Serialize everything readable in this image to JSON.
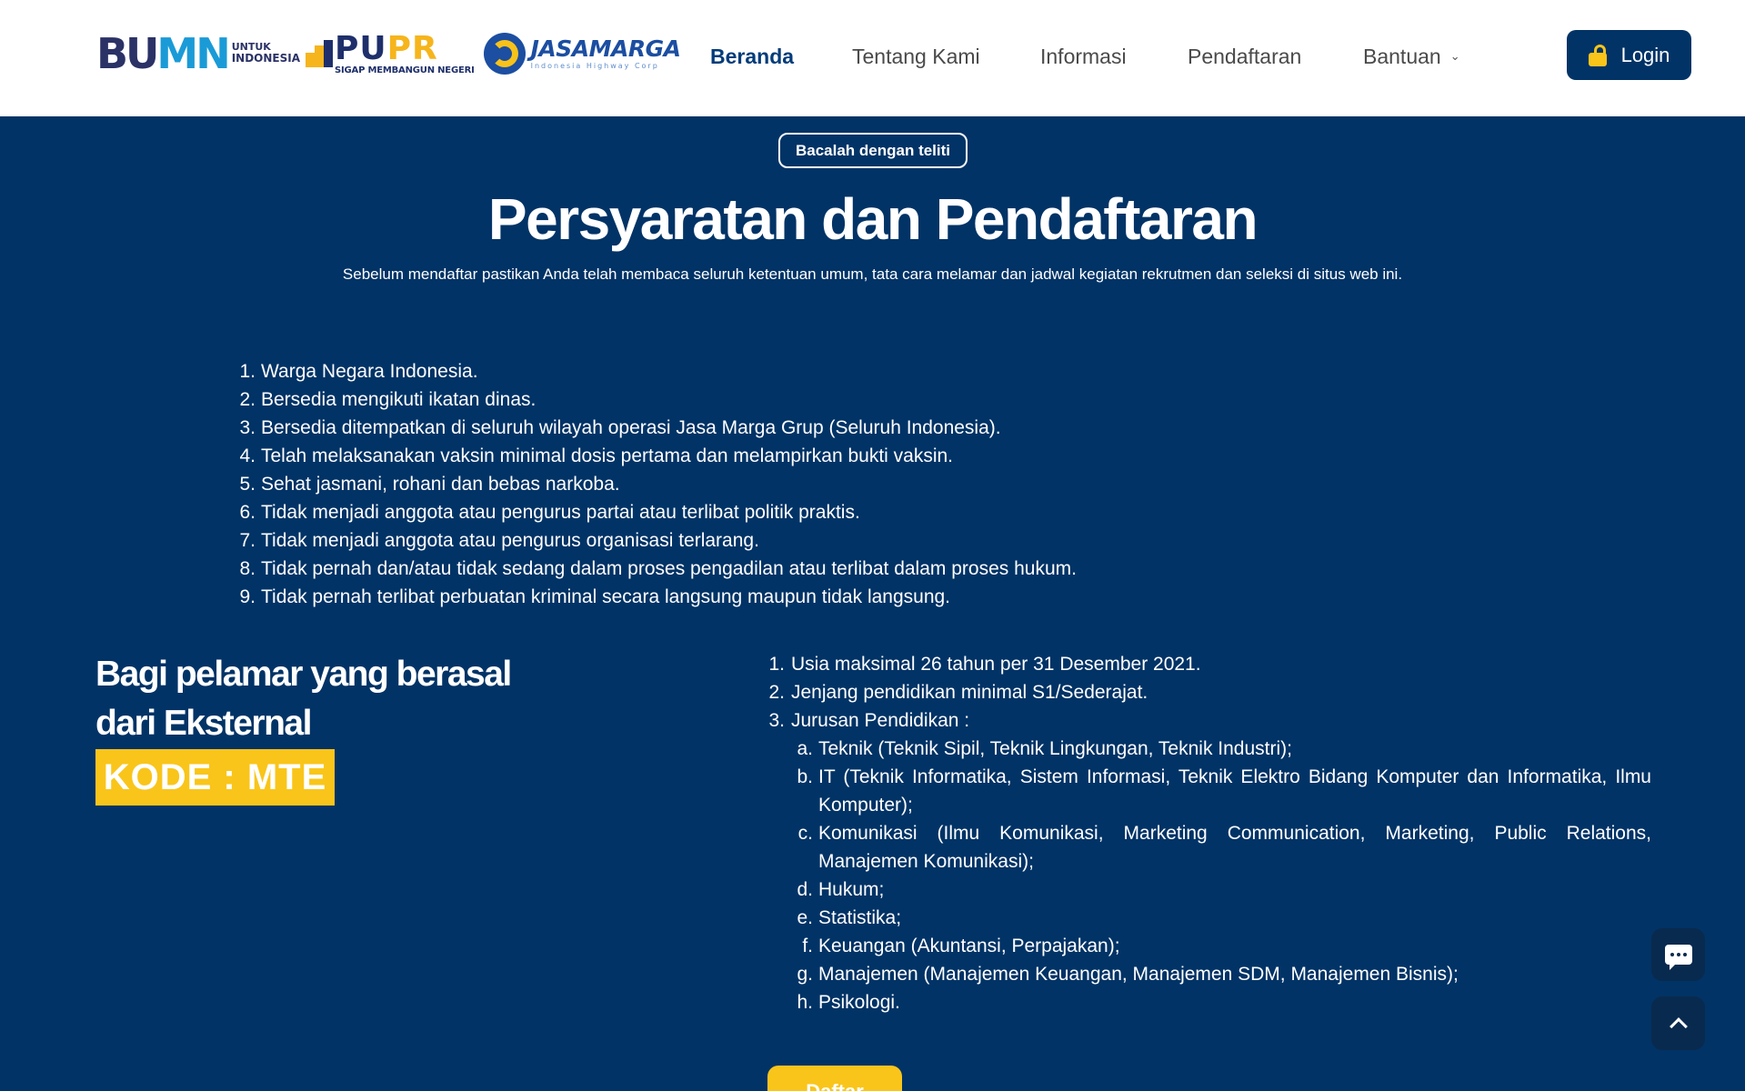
{
  "header": {
    "logos": {
      "bumn": {
        "word_a": "BU",
        "word_b": "MN",
        "sub_1": "UNTUK",
        "sub_2": "INDONESIA"
      },
      "pupr": {
        "word_a": "PU",
        "word_b": "PR",
        "tagline": "SIGAP MEMBANGUN NEGERI"
      },
      "jasamarga": {
        "word": "JASAMARGA",
        "tagline": "Indonesia Highway Corp"
      }
    },
    "nav": [
      {
        "label": "Beranda",
        "active": true
      },
      {
        "label": "Tentang Kami"
      },
      {
        "label": "Informasi"
      },
      {
        "label": "Pendaftaran"
      },
      {
        "label": "Bantuan",
        "dropdown": true
      }
    ],
    "login_label": "Login"
  },
  "hero": {
    "badge": "Bacalah dengan teliti",
    "title": "Persyaratan dan Pendaftaran",
    "subtitle": "Sebelum mendaftar pastikan Anda telah membaca seluruh ketentuan umum, tata cara melamar dan jadwal kegiatan rekrutmen dan seleksi di situs web ini."
  },
  "general_requirements": [
    {
      "num": "1.",
      "text": "Warga Negara Indonesia."
    },
    {
      "num": "2.",
      "text": "Bersedia mengikuti ikatan dinas."
    },
    {
      "num": "3.",
      "text": "Bersedia ditempatkan di seluruh wilayah operasi Jasa Marga Grup (Seluruh Indonesia)."
    },
    {
      "num": "4.",
      "text": "Telah melaksanakan vaksin minimal dosis pertama dan melampirkan bukti vaksin."
    },
    {
      "num": "5.",
      "text": "Sehat jasmani, rohani dan bebas narkoba."
    },
    {
      "num": "6.",
      "text": "Tidak menjadi anggota atau pengurus partai atau terlibat politik praktis."
    },
    {
      "num": "7.",
      "text": "Tidak menjadi anggota atau pengurus organisasi terlarang."
    },
    {
      "num": "8.",
      "text": "Tidak pernah dan/atau tidak sedang dalam proses pengadilan atau terlibat dalam proses hukum."
    },
    {
      "num": "9.",
      "text": "Tidak pernah terlibat perbuatan kriminal secara langsung maupun tidak langsung."
    }
  ],
  "external": {
    "heading_line1": "Bagi pelamar yang berasal",
    "heading_line2": "dari Eksternal",
    "code": "KODE : MTE",
    "requirements": [
      {
        "num": "1.",
        "text": "Usia maksimal 26 tahun per 31 Desember 2021."
      },
      {
        "num": "2.",
        "text": "Jenjang pendidikan minimal S1/Sederajat."
      },
      {
        "num": "3.",
        "text": "Jurusan Pendidikan :"
      }
    ],
    "majors": [
      {
        "letter": "a.",
        "text": "Teknik (Teknik Sipil, Teknik Lingkungan, Teknik Industri);"
      },
      {
        "letter": "b.",
        "text": "IT (Teknik Informatika, Sistem Informasi, Teknik Elektro Bidang Komputer dan Informatika, Ilmu Komputer);"
      },
      {
        "letter": "c.",
        "text": "Komunikasi (Ilmu Komunikasi, Marketing Communication, Marketing, Public Relations, Manajemen Komunikasi);"
      },
      {
        "letter": "d.",
        "text": "Hukum;"
      },
      {
        "letter": "e.",
        "text": "Statistika;"
      },
      {
        "letter": "f.",
        "text": "Keuangan (Akuntansi, Perpajakan);"
      },
      {
        "letter": "g.",
        "text": "Manajemen (Manajemen Keuangan, Manajemen SDM, Manajemen Bisnis);"
      },
      {
        "letter": "h.",
        "text": "Psikologi."
      }
    ],
    "register_label": "Daftar"
  },
  "colors": {
    "primary": "#013366",
    "accent": "#F9C51A",
    "header_bg": "#FFFFFF",
    "floating_btn": "#092A4F"
  },
  "icons": {
    "login": "lock-icon",
    "bantuan": "chevron-down-icon",
    "chat": "chat-icon",
    "scroll_top": "chevron-up-icon"
  }
}
